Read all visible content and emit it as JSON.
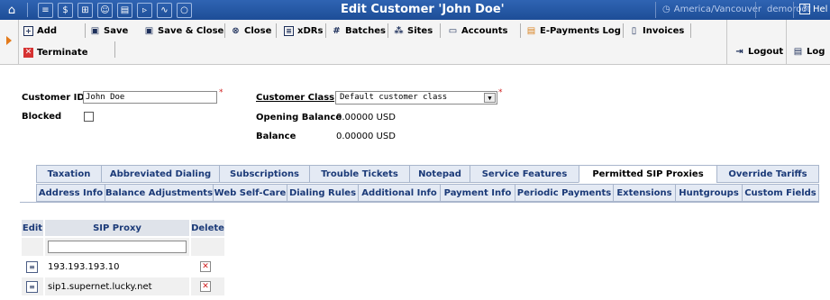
{
  "header": {
    "title": "Edit Customer 'John Doe'",
    "timezone": "America/Vancouver",
    "user": "demoroot",
    "help_label": "Hel"
  },
  "toolbar": {
    "add": "Add",
    "save": "Save",
    "save_close": "Save & Close",
    "close": "Close",
    "xdrs": "xDRs",
    "batches": "Batches",
    "sites": "Sites",
    "accounts": "Accounts",
    "epayments": "E-Payments Log",
    "invoices": "Invoices",
    "terminate": "Terminate",
    "logout": "Logout",
    "log": "Log"
  },
  "form": {
    "customer_id_label": "Customer ID",
    "customer_id_value": "John Doe",
    "blocked_label": "Blocked",
    "customer_class_label": "Customer Class",
    "customer_class_value": "Default customer class",
    "opening_balance_label": "Opening Balance",
    "opening_balance_value": "0.00000 USD",
    "balance_label": "Balance",
    "balance_value": "0.00000 USD"
  },
  "tabs_row1": [
    "Taxation",
    "Abbreviated Dialing",
    "Subscriptions",
    "Trouble Tickets",
    "Notepad",
    "Service Features",
    "Permitted SIP Proxies",
    "Override Tariffs"
  ],
  "tabs_row2": [
    "Address Info",
    "Balance Adjustments",
    "Web Self-Care",
    "Dialing Rules",
    "Additional Info",
    "Payment Info",
    "Periodic Payments",
    "Extensions",
    "Huntgroups",
    "Custom Fields"
  ],
  "active_tab": "Permitted SIP Proxies",
  "proxy_table": {
    "headers": {
      "edit": "Edit",
      "proxy": "SIP Proxy",
      "delete": "Delete"
    },
    "rows": [
      {
        "proxy": "193.193.193.10"
      },
      {
        "proxy": "sip1.supernet.lucky.net"
      }
    ]
  },
  "colors": {
    "topbar": "#2f64b3",
    "tab_bg": "#e4eaf4",
    "tab_text": "#1b3a78",
    "required": "#d01f1f"
  }
}
